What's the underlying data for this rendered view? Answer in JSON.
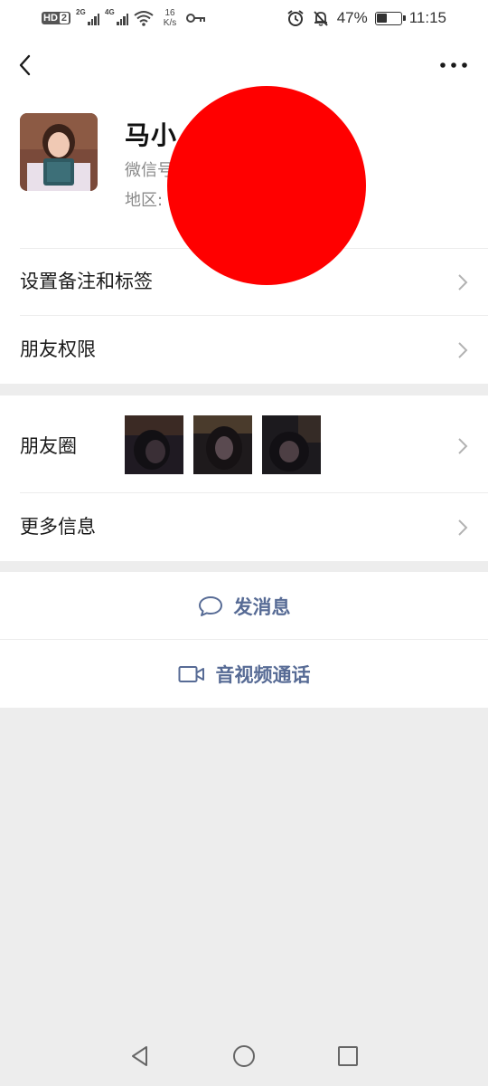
{
  "status_bar": {
    "hd_label": "HD",
    "hd_number": "2",
    "signal1_tag": "2G",
    "signal2_tag": "4G",
    "speed_value": "16",
    "speed_unit": "K/s",
    "battery_percent": "47%",
    "battery_level": 0.47,
    "time": "11:15",
    "icons": [
      "wifi-icon",
      "key-icon",
      "alarm-icon",
      "mute-bell-icon",
      "battery-icon"
    ]
  },
  "nav": {
    "back_icon": "back-chevron-icon",
    "more_icon": "more-dots-icon"
  },
  "profile": {
    "name": "马小",
    "wechat_id_label": "微信号",
    "region_label": "地区:"
  },
  "menu": {
    "set_remark": "设置备注和标签",
    "friend_permissions": "朋友权限",
    "moments": "朋友圈",
    "more_info": "更多信息"
  },
  "actions": {
    "send_message": "发消息",
    "video_call": "音视频通话"
  },
  "colors": {
    "link_blue": "#576b95",
    "redaction": "#ff0000",
    "background": "#ededed"
  }
}
